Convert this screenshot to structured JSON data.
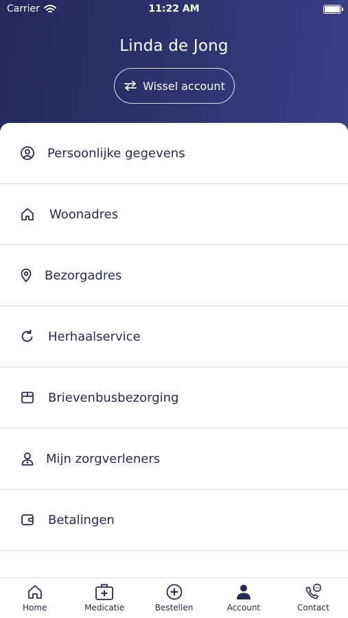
{
  "status_bar": {
    "carrier": "Carrier",
    "time": "11:22 AM"
  },
  "header": {
    "name": "Linda de Jong",
    "switch_label": "Wissel account"
  },
  "menu": [
    {
      "label": "Persoonlijke gegevens",
      "icon": "user-circle-icon"
    },
    {
      "label": "Woonadres",
      "icon": "home-icon"
    },
    {
      "label": "Bezorgadres",
      "icon": "location-pin-icon"
    },
    {
      "label": "Herhaalservice",
      "icon": "refresh-icon"
    },
    {
      "label": "Brievenbusbezorging",
      "icon": "package-icon"
    },
    {
      "label": "Mijn zorgverleners",
      "icon": "doctor-icon"
    },
    {
      "label": "Betalingen",
      "icon": "wallet-icon"
    }
  ],
  "tabs": [
    {
      "label": "Home",
      "icon": "home-icon"
    },
    {
      "label": "Medicatie",
      "icon": "medkit-icon"
    },
    {
      "label": "Bestellen",
      "icon": "plus-circle-icon"
    },
    {
      "label": "Account",
      "icon": "person-icon",
      "active": true
    },
    {
      "label": "Contact",
      "icon": "phone-chat-icon"
    }
  ],
  "colors": {
    "header_start": "#24285a",
    "header_end": "#3a4086",
    "text": "#262a55"
  }
}
